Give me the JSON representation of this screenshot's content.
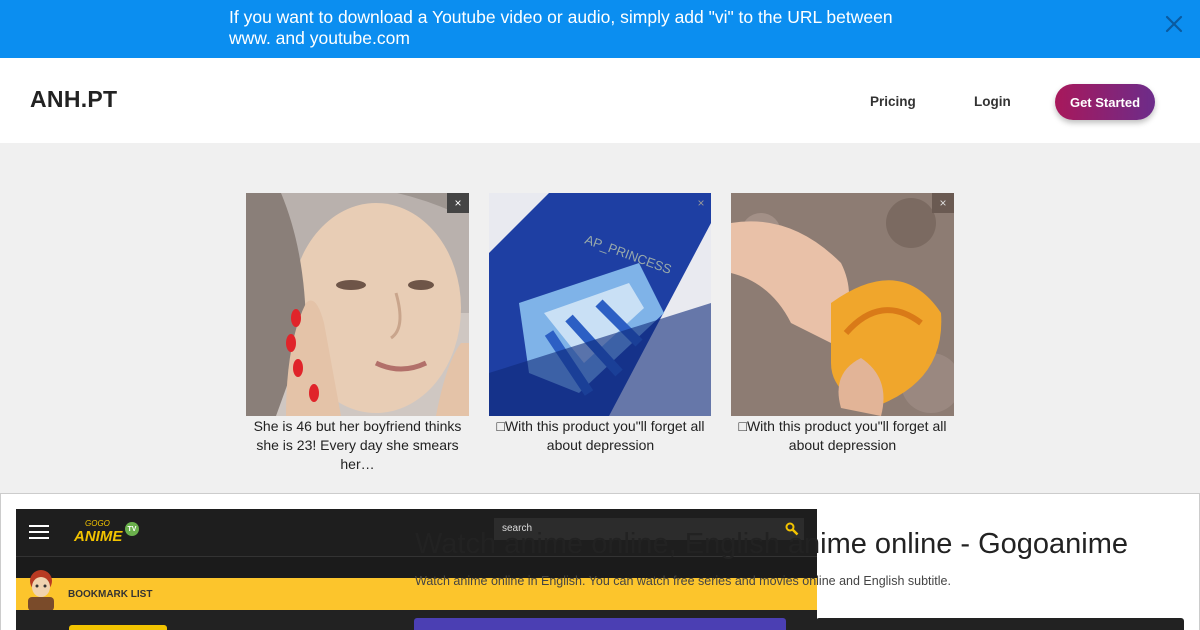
{
  "banner": {
    "message": "If you want to download a Youtube video or audio, simply add \"vi\" to the URL between www. and youtube.com",
    "bg_color": "#0b8ef0",
    "close_icon": "close-icon"
  },
  "nav": {
    "logo": "ANH.PT",
    "links": [
      "Pricing",
      "Login"
    ],
    "cta": "Get Started",
    "cta_gradient": [
      "#a8185b",
      "#6c2c8a"
    ]
  },
  "ads": [
    {
      "caption": "She is 46 but her boyfriend thinks she is 23! Every day she smears her…",
      "image": "woman-face-photo"
    },
    {
      "caption": "□With this product you\"ll forget all about depression",
      "image": "blue-slime-photo"
    },
    {
      "caption": "□With this product you\"ll forget all about depression",
      "image": "peach-hand-photo"
    }
  ],
  "ad_close_glyph": "×",
  "preview": {
    "screenshot": {
      "logo_small": "GOGO",
      "logo_main": "ANIME",
      "logo_badge": "TV",
      "search_placeholder": "search",
      "bookmark_label": "BOOKMARK LIST",
      "accent_color": "#fcc52c"
    },
    "title": "Watch anime online, English anime online - Gogoanime",
    "description": "Watch anime online in English. You can watch free series and movies online and English subtitle."
  }
}
